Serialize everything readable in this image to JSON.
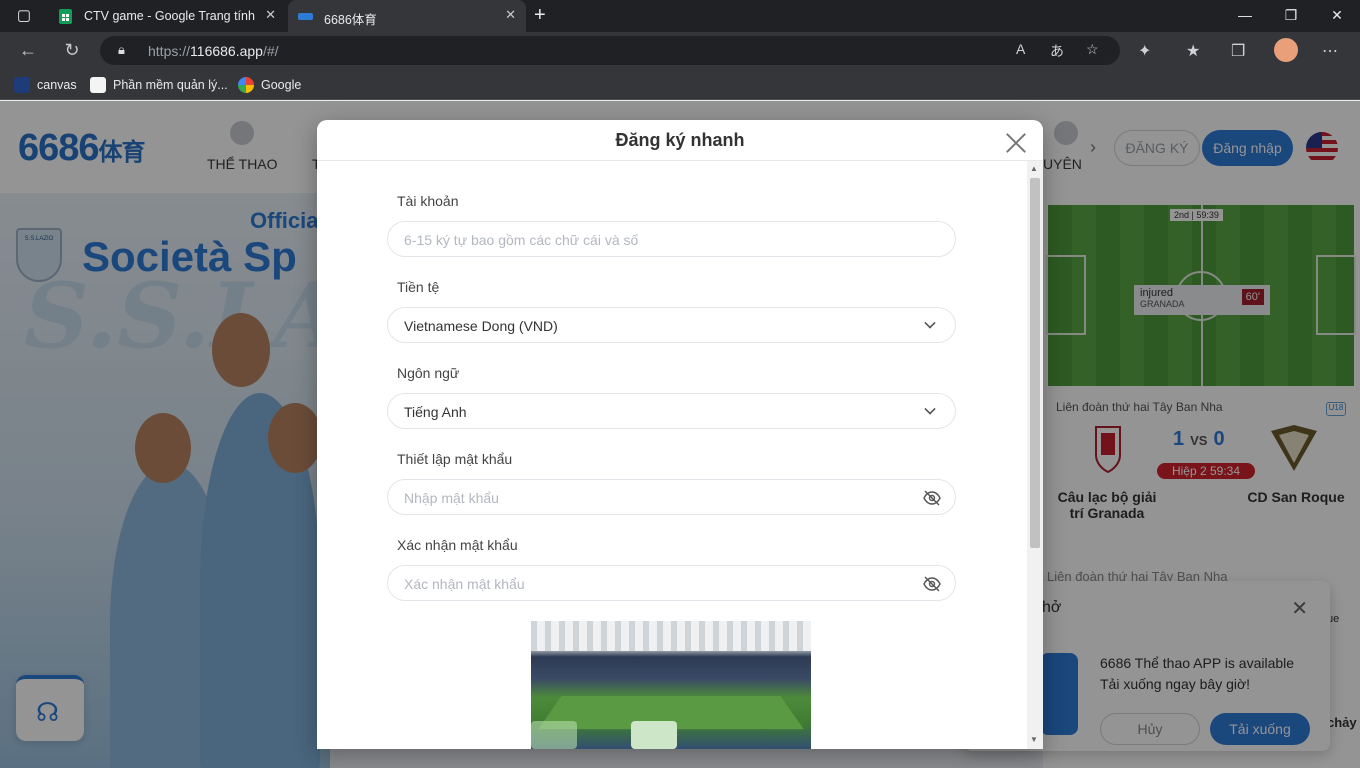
{
  "browser": {
    "tabs": [
      {
        "title": "CTV game - Google Trang tính",
        "favicon": "sheets-icon",
        "color": "#0f9d58"
      },
      {
        "title": "6686体育",
        "favicon": "site-icon",
        "color": "#2e7bd6"
      }
    ],
    "url_prefix": "https://",
    "url_host": "116686.app",
    "url_path": "/#/",
    "bookmarks": [
      {
        "label": "canvas",
        "icon": "canvas-icon"
      },
      {
        "label": "Phần mềm quản lý...",
        "icon": "document-icon"
      },
      {
        "label": "Google",
        "icon": "google-icon"
      }
    ]
  },
  "site": {
    "logo_num": "6686",
    "logo_cn": "体育",
    "nav": [
      {
        "label": "THỂ THAO"
      },
      {
        "label": "T"
      },
      {
        "label": "UYÊN"
      }
    ],
    "register_label": "ĐĂNG KÝ",
    "login_label": "Đăng nhập",
    "banner": {
      "line1": "Officia",
      "line2": "Società Sp",
      "watermark": "S.S.LA",
      "crest": "S.S.LAZIO"
    }
  },
  "match": {
    "clock": "2nd | 59:39",
    "event_title": "injured",
    "event_team": "GRANADA",
    "event_minute": "60'",
    "league": "Liên đoàn thứ hai Tây Ban Nha",
    "league_badge": "U18",
    "home_score": "1",
    "vs": "VS",
    "away_score": "0",
    "status": "Hiệp 2  59:34",
    "home_team": "Câu lạc bộ giải trí Granada",
    "away_team": "CD San Roque",
    "league_next": "Liên đoàn thứ hai Tây Ban Nha",
    "peek_1": "ue",
    "peek_2": "chảy"
  },
  "app_popup": {
    "title": "hở",
    "text_line1": "6686 Thể thao  APP is available",
    "text_line2": "Tải xuống ngay bây giờ!",
    "cancel": "Hủy",
    "download": "Tải xuống"
  },
  "modal": {
    "title": "Đăng ký nhanh",
    "account_label": "Tài khoản",
    "account_placeholder": "6-15 ký tự bao gồm các chữ cái và số",
    "currency_label": "Tiền tệ",
    "currency_value": "Vietnamese Dong (VND)",
    "language_label": "Ngôn ngữ",
    "language_value": "Tiếng Anh",
    "password_label": "Thiết lập mật khẩu",
    "password_placeholder": "Nhập mật khẩu",
    "confirm_label": "Xác nhận mật khẩu",
    "confirm_placeholder": "Xác nhận mật khẩu"
  },
  "colors": {
    "brand": "#2e7bd6",
    "danger": "#d3242f",
    "overlay": "rgba(0,0,0,0.42)"
  }
}
